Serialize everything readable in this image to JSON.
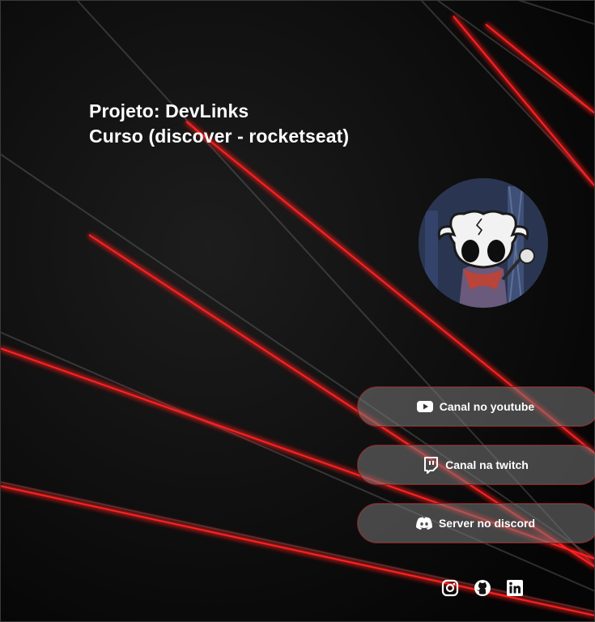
{
  "header": {
    "line1": "Projeto: DevLinks",
    "line2": "Curso (discover - rocketseat)"
  },
  "profile": {
    "avatar_icon": "hollow-knight-avatar"
  },
  "links": [
    {
      "label": "Canal no youtube",
      "icon": "youtube-icon"
    },
    {
      "label": "Canal na twitch",
      "icon": "twitch-icon"
    },
    {
      "label": "Server no discord",
      "icon": "discord-icon"
    }
  ],
  "socials": [
    {
      "icon": "instagram-icon"
    },
    {
      "icon": "github-icon"
    },
    {
      "icon": "linkedin-icon"
    }
  ],
  "theme": {
    "background": "#0b0b0b",
    "accent": "#e10000",
    "button_fill": "#787878",
    "button_border": "#8a1a1a",
    "text": "#ffffff"
  }
}
